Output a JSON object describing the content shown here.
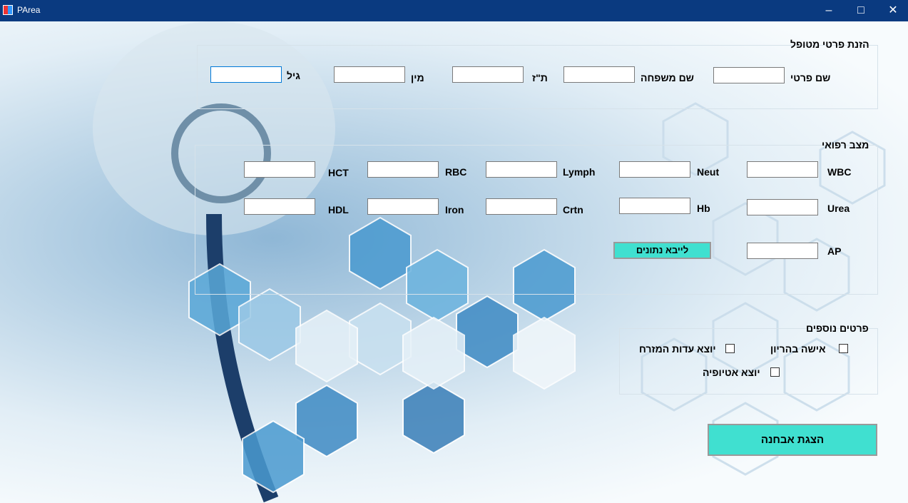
{
  "window": {
    "title": "PArea"
  },
  "patient_details": {
    "group_title": "הזנת פרטי מטופל",
    "first_name_label": "שם פרטי",
    "last_name_label": "שם משפחה",
    "id_label": "ת\"ז",
    "gender_label": "מין",
    "age_label": "גיל",
    "first_name_value": "",
    "last_name_value": "",
    "id_value": "",
    "gender_value": "",
    "age_value": ""
  },
  "medical_state": {
    "group_title": "מצב רפואי",
    "labels": {
      "wbc": "WBC",
      "neut": "Neut",
      "lymph": "Lymph",
      "rbc": "RBC",
      "hct": "HCT",
      "urea": "Urea",
      "hb": "Hb",
      "crtn": "Crtn",
      "iron": "Iron",
      "hdl": "HDL",
      "ap": "AP"
    },
    "import_button_label": "לייבא נתונים"
  },
  "additional_details": {
    "group_title": "פרטים נוספים",
    "pregnant_label": "אישה בהריון",
    "eastern_label": "יוצא עדות המזרח",
    "ethiopian_label": "יוצא אטיופיה",
    "pregnant_checked": false,
    "eastern_checked": false,
    "ethiopian_checked": false
  },
  "diagnosis_button_label": "הצגת אבחנה",
  "colors": {
    "titlebar": "#0a3a80",
    "accent_button": "#40e0d0"
  },
  "icons": [
    "minimize-icon",
    "maximize-icon",
    "close-icon",
    "app-icon"
  ]
}
